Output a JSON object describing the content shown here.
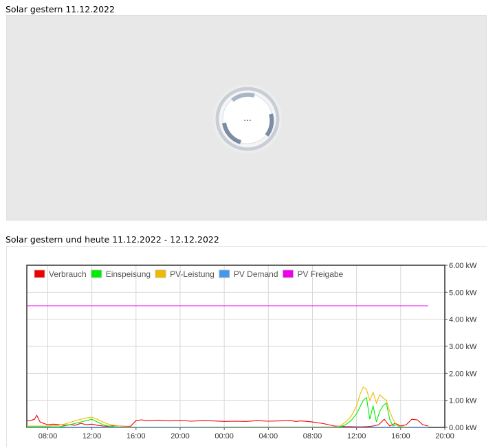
{
  "section1": {
    "title": "Solar gestern 11.12.2022",
    "loading_text": "..."
  },
  "section2": {
    "title": "Solar gestern und heute 11.12.2022 - 12.12.2022"
  },
  "chart_data": {
    "type": "line",
    "title": "",
    "xlabel": "",
    "ylabel": "",
    "x_ticks": [
      "08:00",
      "12:00",
      "16:00",
      "20:00",
      "00:00",
      "04:00",
      "08:00",
      "12:00",
      "16:00",
      "20:00"
    ],
    "x_range_hours": [
      6.1,
      44
    ],
    "y_ticks": [
      "0.00 kW",
      "1.00 kW",
      "2.00 kW",
      "3.00 kW",
      "4.00 kW",
      "5.00 kW",
      "6.00 kW"
    ],
    "ylim": [
      0,
      6
    ],
    "grid": true,
    "legend_position": "top-left",
    "series": [
      {
        "name": "Verbrauch",
        "color": "#ee0000",
        "x": [
          6.1,
          6.4,
          6.8,
          7.0,
          7.3,
          7.6,
          8.0,
          8.5,
          9.0,
          9.5,
          10.0,
          10.5,
          11.0,
          11.5,
          12.0,
          12.5,
          13.0,
          13.5,
          14.0,
          14.5,
          15.0,
          15.5,
          16.0,
          16.5,
          17.0,
          18.0,
          19.0,
          20.0,
          21.0,
          22.0,
          23.0,
          24.0,
          25.0,
          26.0,
          27.0,
          28.0,
          29.0,
          30.0,
          30.5,
          31.0,
          31.5,
          32.0,
          33.0,
          34.0,
          35.0,
          36.0,
          36.5,
          37.0,
          37.5,
          38.0,
          38.5,
          39.0,
          39.5,
          40.0,
          40.5,
          41.0,
          41.5,
          42.0,
          42.5
        ],
        "y": [
          0.25,
          0.25,
          0.3,
          0.45,
          0.2,
          0.15,
          0.1,
          0.12,
          0.1,
          0.08,
          0.1,
          0.08,
          0.15,
          0.1,
          0.12,
          0.08,
          0.05,
          0.04,
          0.06,
          0.05,
          0.04,
          0.04,
          0.25,
          0.28,
          0.25,
          0.27,
          0.24,
          0.26,
          0.23,
          0.25,
          0.24,
          0.22,
          0.23,
          0.22,
          0.25,
          0.23,
          0.24,
          0.25,
          0.22,
          0.24,
          0.22,
          0.2,
          0.14,
          0.05,
          0.03,
          0.02,
          0.02,
          0.03,
          0.05,
          0.1,
          0.3,
          0.05,
          0.15,
          0.05,
          0.1,
          0.3,
          0.28,
          0.1,
          0.05
        ]
      },
      {
        "name": "Einspeisung",
        "color": "#00ee00",
        "x": [
          6.1,
          9.0,
          9.5,
          10.0,
          10.5,
          11.0,
          11.5,
          12.0,
          12.5,
          13.0,
          13.5,
          14.0,
          14.5,
          15.0,
          30.0,
          34.0,
          34.5,
          35.0,
          35.5,
          36.0,
          36.3,
          36.6,
          36.9,
          37.2,
          37.5,
          37.8,
          38.1,
          38.4,
          38.7,
          39.0,
          39.3,
          39.6,
          40.0,
          40.5,
          41.0,
          42.5
        ],
        "y": [
          0.02,
          0.02,
          0.05,
          0.1,
          0.15,
          0.2,
          0.25,
          0.3,
          0.2,
          0.1,
          0.05,
          0.02,
          0.0,
          0.0,
          0.0,
          0.0,
          0.02,
          0.1,
          0.25,
          0.5,
          0.75,
          1.0,
          1.1,
          0.3,
          0.8,
          0.2,
          0.6,
          0.8,
          0.9,
          0.3,
          0.05,
          0.1,
          0.0,
          0.0,
          0.0,
          0.0
        ]
      },
      {
        "name": "PV-Leistung",
        "color": "#eebb00",
        "x": [
          6.1,
          8.0,
          9.0,
          9.5,
          10.0,
          10.5,
          11.0,
          11.5,
          12.0,
          12.5,
          13.0,
          13.5,
          14.0,
          14.5,
          15.0,
          15.5,
          16.0,
          34.0,
          34.5,
          35.0,
          35.5,
          36.0,
          36.3,
          36.6,
          36.9,
          37.2,
          37.5,
          37.8,
          38.1,
          38.4,
          38.7,
          39.0,
          39.3,
          39.6,
          40.0,
          40.5,
          41.0,
          42.5
        ],
        "y": [
          0.05,
          0.05,
          0.08,
          0.12,
          0.18,
          0.25,
          0.3,
          0.35,
          0.38,
          0.3,
          0.2,
          0.12,
          0.08,
          0.05,
          0.03,
          0.02,
          0.01,
          0.02,
          0.05,
          0.2,
          0.4,
          0.8,
          1.2,
          1.5,
          1.4,
          1.0,
          1.3,
          0.9,
          1.2,
          1.1,
          1.0,
          0.6,
          0.3,
          0.1,
          0.03,
          0.01,
          0.0,
          0.0
        ]
      },
      {
        "name": "PV Demand",
        "color": "#4499ee",
        "x": [
          6.1,
          42.5
        ],
        "y": [
          0.0,
          0.0
        ]
      },
      {
        "name": "PV Freigabe",
        "color": "#ee00ee",
        "x": [
          6.1,
          42.5
        ],
        "y": [
          4.5,
          4.5
        ]
      }
    ]
  }
}
